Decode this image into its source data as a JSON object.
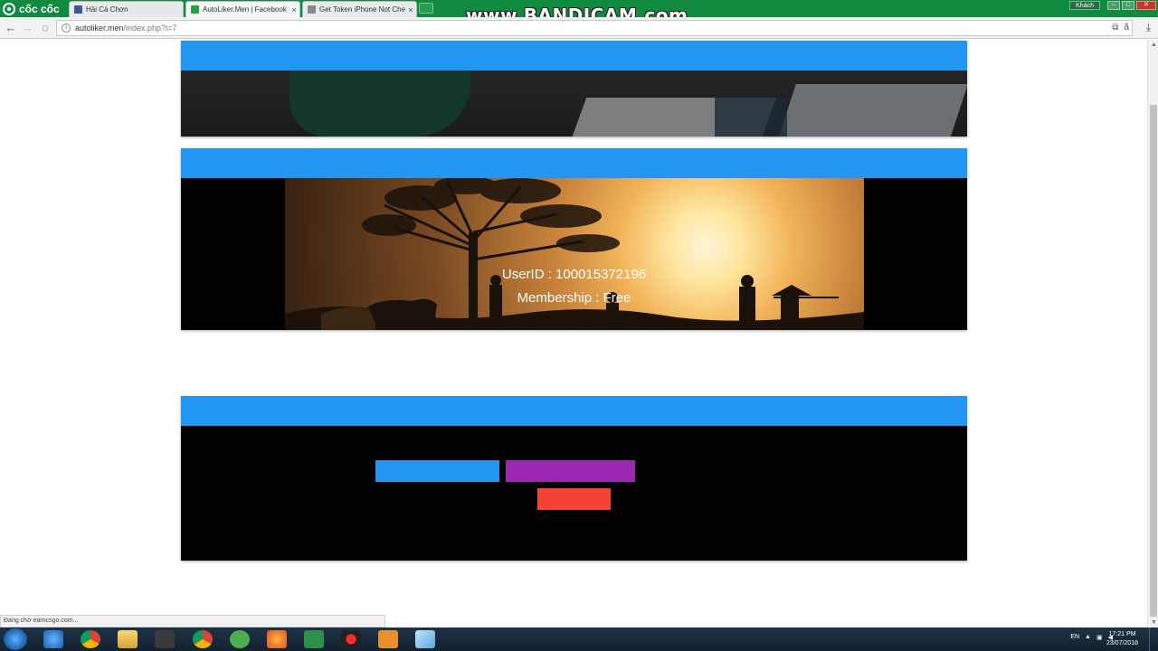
{
  "browser": {
    "brand_label": "cốc cốc",
    "tabs": [
      {
        "label": "Hải Cá Chơn",
        "favicon_color": "#3b5998"
      },
      {
        "label": "AutoLiker.Men | Facebook",
        "favicon_color": "#21a04a"
      },
      {
        "label": "Get Token iPhone Not Che",
        "favicon_color": "#888888"
      }
    ],
    "tab_close_glyph": "×",
    "user_label": "Khách",
    "address": {
      "host": "autoliker.men",
      "path": "/index.php?i=7"
    },
    "status_text": "Đang chờ earncsgo.com..."
  },
  "watermark": "www.BANDICAM.com",
  "page": {
    "user_id_line": "UserID : 100015372196",
    "membership_line": "Membership : Free"
  },
  "taskbar": {
    "language": "EN",
    "time": "17:21 PM",
    "date": "23/07/2018"
  },
  "colors": {
    "header_blue": "#2196f3",
    "button_blue": "#2196f3",
    "button_purple": "#9c27b0",
    "button_red": "#f44336"
  }
}
